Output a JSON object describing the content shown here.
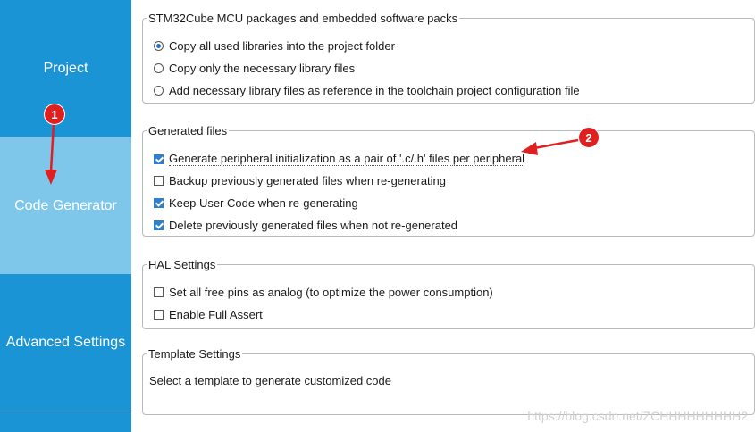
{
  "sidebar": {
    "items": [
      {
        "label": "Project"
      },
      {
        "label": "Code Generator"
      },
      {
        "label": "Advanced Settings"
      }
    ]
  },
  "packages_group": {
    "legend": "STM32Cube MCU packages and embedded software packs",
    "options": [
      {
        "label": "Copy all used libraries into the project folder",
        "selected": true
      },
      {
        "label": "Copy only the necessary library files",
        "selected": false
      },
      {
        "label": "Add necessary library files as reference in the toolchain project configuration file",
        "selected": false
      }
    ]
  },
  "generated_group": {
    "legend": "Generated files",
    "options": [
      {
        "label": "Generate peripheral initialization as a pair of '.c/.h' files per peripheral",
        "checked": true
      },
      {
        "label": "Backup previously generated files when re-generating",
        "checked": false
      },
      {
        "label": "Keep User Code when re-generating",
        "checked": true
      },
      {
        "label": "Delete previously generated files when not re-generated",
        "checked": true
      }
    ]
  },
  "hal_group": {
    "legend": "HAL Settings",
    "options": [
      {
        "label": "Set all free pins as analog (to optimize the power consumption)",
        "checked": false
      },
      {
        "label": "Enable Full Assert",
        "checked": false
      }
    ]
  },
  "template_group": {
    "legend": "Template Settings",
    "text": "Select a template to generate customized code"
  },
  "annotations": {
    "badge1": "1",
    "badge2": "2",
    "color": "#e02020"
  },
  "watermark": "https://blog.csdn.net/ZCHHHHHHHHH2"
}
